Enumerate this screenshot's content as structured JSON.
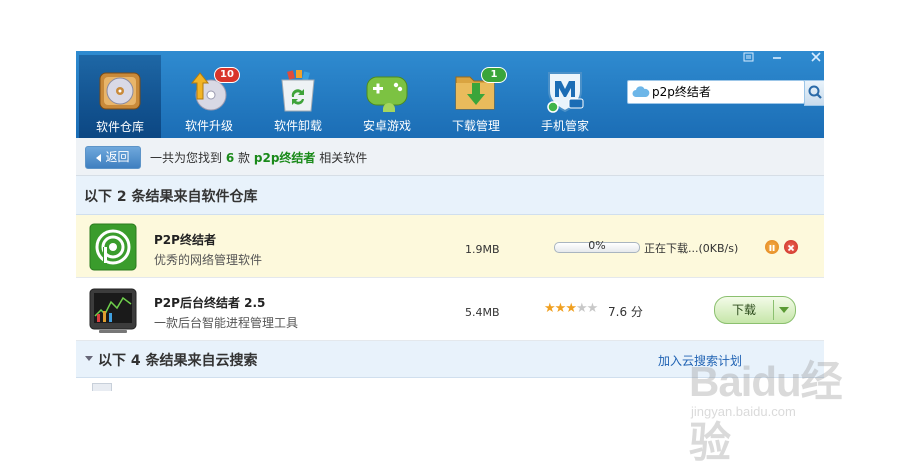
{
  "window_controls": [
    "skin-icon",
    "minimize-icon",
    "close-icon"
  ],
  "nav": {
    "items": [
      {
        "label": "软件仓库",
        "icon": "disc-box-icon",
        "active": true
      },
      {
        "label": "软件升级",
        "icon": "upgrade-disc-icon",
        "badge": "10",
        "badge_color": "#d9352b"
      },
      {
        "label": "软件卸载",
        "icon": "recycle-bin-icon"
      },
      {
        "label": "安卓游戏",
        "icon": "android-gamepad-icon"
      },
      {
        "label": "下载管理",
        "icon": "download-folder-icon",
        "badge": "1",
        "badge_color": "#3aa53a"
      },
      {
        "label": "手机管家",
        "icon": "mobile-shield-icon"
      }
    ]
  },
  "search": {
    "value": "p2p终结者"
  },
  "breadcrumb": {
    "back_label": "返回",
    "prefix": "一共为您找到",
    "count": "6",
    "mid": "款",
    "keyword": "p2p终结者",
    "suffix": "相关软件"
  },
  "section1": {
    "title": "以下 2 条结果来自软件仓库"
  },
  "results": [
    {
      "name": "P2P终结者",
      "desc": "优秀的网络管理软件",
      "size": "1.9MB",
      "progress_text": "0%",
      "progress": 0,
      "status": "正在下载...(0KB/s)"
    },
    {
      "name": "P2P后台终结者 2.5",
      "desc": "一款后台智能进程管理工具",
      "size": "5.4MB",
      "rating": 3,
      "rating_max": 5,
      "score": "7.6 分",
      "button": "下载"
    }
  ],
  "section2": {
    "title": "以下 4 条结果来自云搜索",
    "link": "加入云搜索计划"
  },
  "watermark": {
    "brand": "Baidu经验",
    "url": "jingyan.baidu.com"
  },
  "colors": {
    "accent": "#1b6db5",
    "selected_row": "#fdf9dc",
    "section_bg": "#e8f2fb",
    "keyword": "#1a8a1a",
    "link": "#1f62b3"
  }
}
